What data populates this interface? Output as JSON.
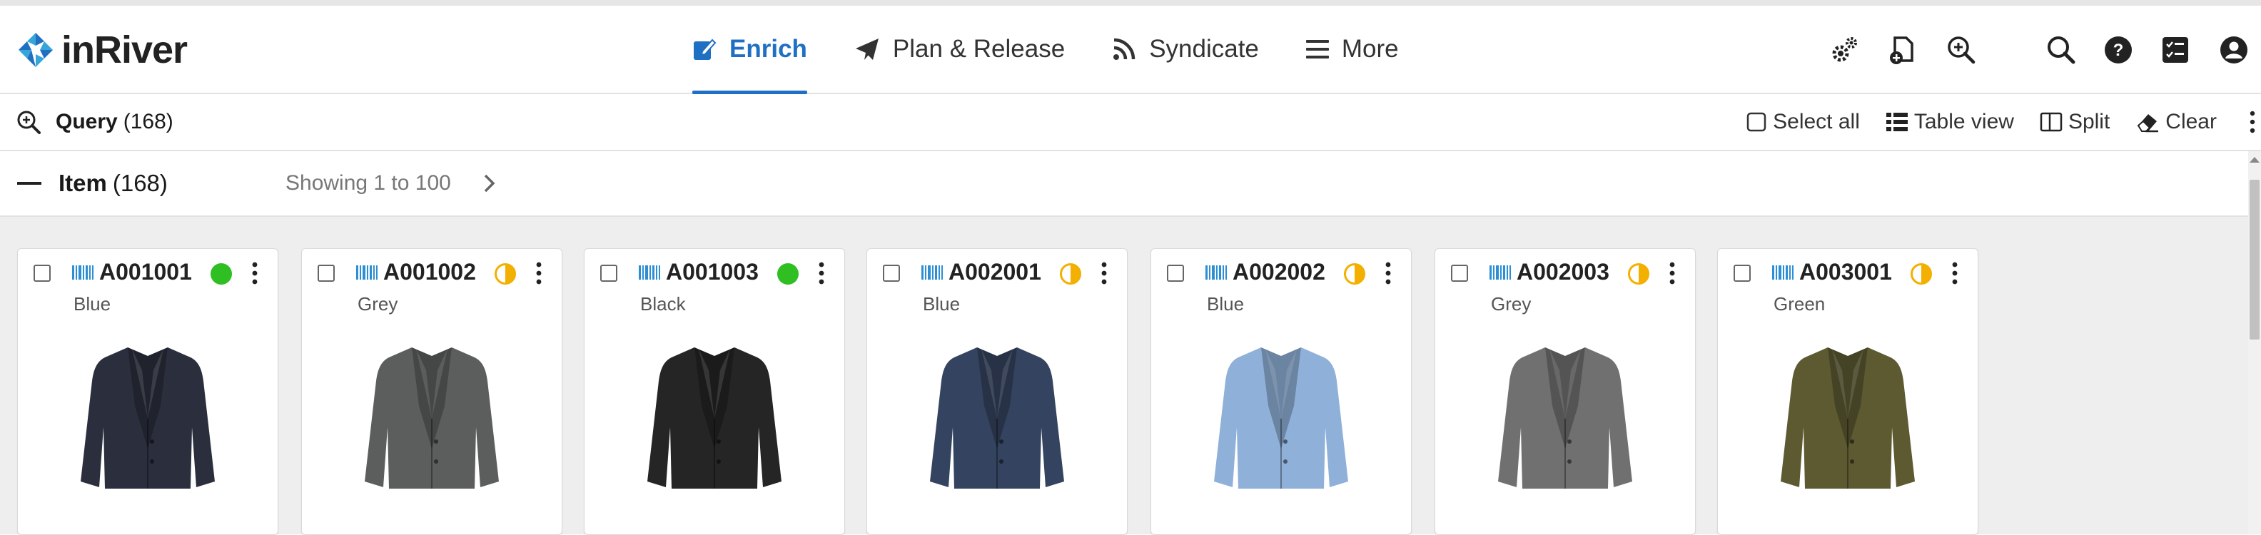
{
  "app": {
    "logo_text": "inRiver"
  },
  "nav": {
    "enrich": "Enrich",
    "plan_release": "Plan & Release",
    "syndicate": "Syndicate",
    "more": "More"
  },
  "header_icons": [
    "gears-icon",
    "new-document-icon",
    "zoom-in-icon",
    "search-icon",
    "help-icon",
    "tasks-icon",
    "user-icon"
  ],
  "query": {
    "label": "Query",
    "count": "(168)"
  },
  "actions": {
    "select_all": "Select all",
    "table_view": "Table view",
    "split": "Split",
    "clear": "Clear"
  },
  "item_section": {
    "label": "Item",
    "count": "(168)",
    "showing": "Showing 1 to 100"
  },
  "colors": {
    "accent": "#1f6fc2",
    "status_complete": "#2fbf22",
    "status_partial": "#f3b000"
  },
  "items": [
    {
      "code": "A001001",
      "color": "Blue",
      "status": "complete",
      "jacket": "#2b2f3d"
    },
    {
      "code": "A001002",
      "color": "Grey",
      "status": "partial",
      "jacket": "#5c5e5e"
    },
    {
      "code": "A001003",
      "color": "Black",
      "status": "complete",
      "jacket": "#252525"
    },
    {
      "code": "A002001",
      "color": "Blue",
      "status": "partial",
      "jacket": "#34435f"
    },
    {
      "code": "A002002",
      "color": "Blue",
      "status": "partial",
      "jacket": "#8fb0d8"
    },
    {
      "code": "A002003",
      "color": "Grey",
      "status": "partial",
      "jacket": "#707070"
    },
    {
      "code": "A003001",
      "color": "Green",
      "status": "partial",
      "jacket": "#5d5a32"
    }
  ]
}
